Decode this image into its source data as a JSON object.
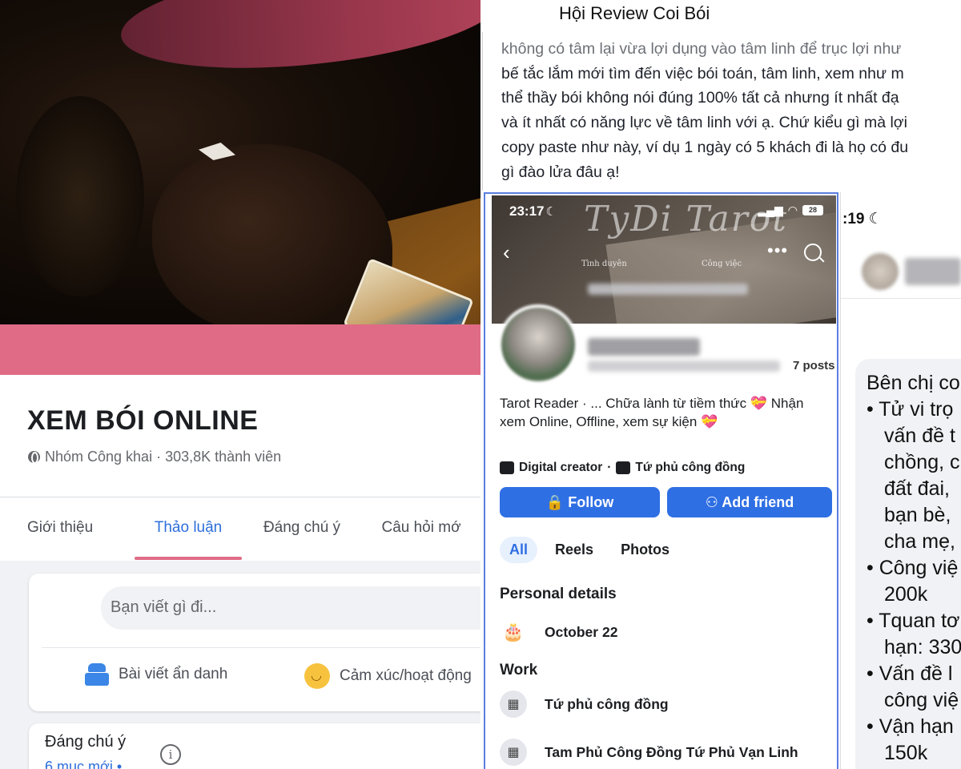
{
  "left": {
    "group_name": "XEM BÓI ONLINE",
    "group_meta": "Nhóm Công khai · 303,8K thành viên",
    "tabs": [
      "Giới thiệu",
      "Thảo luận",
      "Đáng chú ý",
      "Câu hỏi mớ"
    ],
    "active_tab": "Thảo luận",
    "composer_placeholder": "Bạn viết gì đi...",
    "anon_label": "Bài viết ẩn danh",
    "feeling_label": "Cảm xúc/hoạt động",
    "highlight_title": "Đáng chú ý",
    "highlight_sub": "6 mục mới •",
    "info_glyph": "i",
    "accent_pink": "#e06b86",
    "link_blue": "#2d6fdb"
  },
  "right": {
    "group_title": "Hội Review Coi Bói",
    "post_lines": [
      "không có tâm lại vừa lợi dụng vào tâm linh để trục lợi như",
      "bế tắc lắm mới tìm đến việc bói toán, tâm linh, xem như m",
      "thể thầy bói không nói đúng 100% tất cả nhưng ít nhất đạ",
      "và ít nhất có năng lực về tâm linh với ạ. Chứ kiểu gì mà lợi",
      "copy paste như này, ví dụ 1 ngày có 5 khách đi là họ có đu",
      "gì đào lửa đâu ạ!"
    ],
    "shot1": {
      "status_time": "23:17",
      "battery": "28",
      "logo_text": "TyDi Tarot",
      "cover_caption_1": "Tình duyên",
      "cover_caption_2": "Công việc",
      "posts_count": "7 posts",
      "bio": "Tarot Reader · ... Chữa lành từ tiềm thức 💝 Nhận xem Online, Offline, xem sự kiện 💝",
      "category": "Digital creator",
      "category_sep": "·",
      "workplace_short": "Tứ phủ công đồng",
      "follow_label": "Follow",
      "add_friend_label": "Add friend",
      "tabs": [
        "All",
        "Reels",
        "Photos"
      ],
      "personal_title": "Personal details",
      "birthday": "October 22",
      "work_title": "Work",
      "work_1": "Tứ phủ công đồng",
      "work_2": "Tam Phủ Công Đồng Tứ Phủ Vạn Linh",
      "accent_blue": "#2f6fe4"
    },
    "shot2": {
      "status_time": ":19",
      "lines": [
        "Bên chị co",
        "• Tử vi trọ",
        "vấn đề t",
        "chồng, c",
        "đất đai,",
        "bạn bè,",
        "cha mẹ,",
        "• Công việ",
        "200k",
        "• Tquan tơ",
        "hạn: 330",
        "• Vấn đề l",
        "công việ",
        "• Vận hạn",
        "150k"
      ]
    }
  }
}
